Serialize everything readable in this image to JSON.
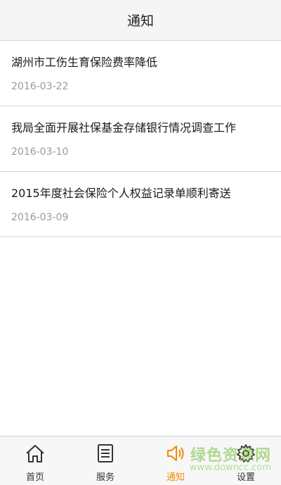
{
  "header": {
    "title": "通知"
  },
  "notices": [
    {
      "title": "湖州市工伤生育保险费率降低",
      "date": "2016-03-22"
    },
    {
      "title": "我局全面开展社保基金存储银行情况调查工作",
      "date": "2016-03-10"
    },
    {
      "title": "2015年度社会保险个人权益记录单顺利寄送",
      "date": "2016-03-09"
    }
  ],
  "tabs": [
    {
      "label": "首页",
      "icon": "home-icon"
    },
    {
      "label": "服务",
      "icon": "list-icon"
    },
    {
      "label": "通知",
      "icon": "speaker-icon",
      "active": true
    },
    {
      "label": "设置",
      "icon": "gear-icon"
    }
  ],
  "colors": {
    "accent": "#f08a00",
    "icon": "#333333"
  },
  "watermark": {
    "main": "绿色资源网",
    "sub": "www.downcc.com"
  }
}
